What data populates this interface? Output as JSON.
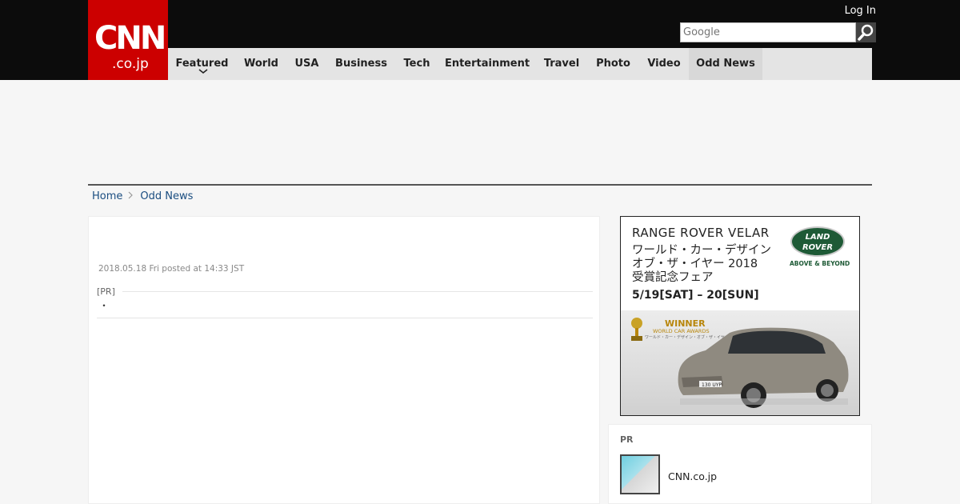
{
  "header": {
    "logo_text": "CNN",
    "logo_sub": ".co.jp",
    "login_label": "Log In",
    "search": {
      "placeholder": "Google",
      "icon": "search-icon"
    }
  },
  "nav": {
    "items": [
      {
        "label": "Featured",
        "has_dropdown": true
      },
      {
        "label": "World"
      },
      {
        "label": "USA"
      },
      {
        "label": "Business"
      },
      {
        "label": "Tech"
      },
      {
        "label": "Entertainment"
      },
      {
        "label": "Travel"
      },
      {
        "label": "Photo"
      },
      {
        "label": "Video"
      },
      {
        "label": "Odd News",
        "active": true
      }
    ]
  },
  "breadcrumb": {
    "home": "Home",
    "current": "Odd News"
  },
  "article": {
    "date": "2018.05.18 Fri posted at 14:33 JST",
    "pr_label": "[PR]",
    "pr_item": "・"
  },
  "ad": {
    "line1": "RANGE ROVER VELAR",
    "line2": "ワールド・カー・デザイン",
    "line3": "オブ・ザ・イヤー 2018",
    "line4": "受賞記念フェア",
    "line5": "5/19[SAT] – 20[SUN]",
    "brand": "LAND ROVER",
    "tagline": "ABOVE & BEYOND",
    "winner": "WINNER",
    "award": "WORLD CAR AWARDS",
    "award_sub": "ワールド・カー・デザイン・オブ・ザ・イヤー 2018",
    "plate": "130 UYP"
  },
  "pr_box": {
    "title": "PR",
    "items": [
      {
        "label": "CNN.co.jp"
      }
    ]
  },
  "colors": {
    "brand_red": "#cc0000",
    "header_bg": "#0c0c0c",
    "link": "#1a4d80"
  }
}
